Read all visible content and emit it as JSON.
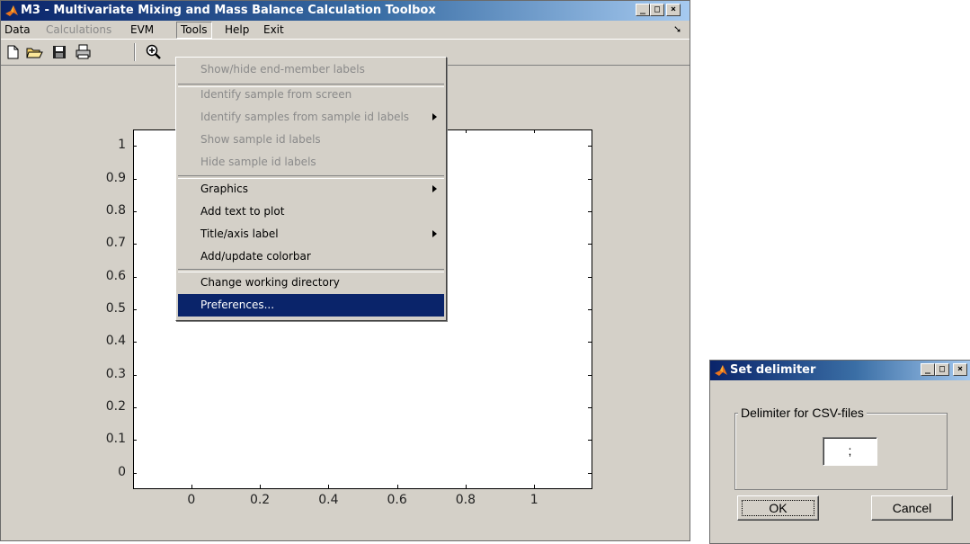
{
  "main_window": {
    "title": "M3 - Multivariate Mixing and Mass Balance Calculation Toolbox",
    "menubar": [
      {
        "label": "Data",
        "disabled": false
      },
      {
        "label": "Calculations",
        "disabled": true
      },
      {
        "label": "EVM",
        "disabled": false
      },
      {
        "label": "Tools",
        "disabled": false,
        "open": true
      },
      {
        "label": "Help",
        "disabled": false
      },
      {
        "label": "Exit",
        "disabled": false
      }
    ],
    "toolbar_icons": [
      "new-file-icon",
      "open-folder-icon",
      "save-icon",
      "print-icon",
      "zoom-in-icon"
    ]
  },
  "tools_menu": {
    "items": [
      {
        "label": "Show/hide end-member labels",
        "disabled": true
      },
      {
        "label": "Identify sample from screen",
        "disabled": true
      },
      {
        "label": "Identify samples from sample id labels",
        "disabled": true,
        "submenu": true
      },
      {
        "label": "Show sample id labels",
        "disabled": true
      },
      {
        "label": "Hide sample id labels",
        "disabled": true
      },
      {
        "label": "Graphics",
        "disabled": false,
        "submenu": true
      },
      {
        "label": "Add text to plot",
        "disabled": false
      },
      {
        "label": "Title/axis label",
        "disabled": false,
        "submenu": true
      },
      {
        "label": "Add/update colorbar",
        "disabled": false
      },
      {
        "label": "Change working directory",
        "disabled": false
      },
      {
        "label": "Preferences...",
        "disabled": false,
        "highlighted": true
      }
    ]
  },
  "chart_data": {
    "type": "scatter",
    "x_ticks": [
      "0",
      "0.2",
      "0.4",
      "0.6",
      "0.8",
      "1"
    ],
    "y_ticks": [
      "0",
      "0.1",
      "0.2",
      "0.3",
      "0.4",
      "0.5",
      "0.6",
      "0.7",
      "0.8",
      "0.9",
      "1"
    ],
    "xlim": [
      -0.17,
      1.17
    ],
    "ylim": [
      -0.05,
      1.05
    ],
    "series": []
  },
  "dialog": {
    "title": "Set delimiter",
    "group_label": "Delimiter for CSV-files",
    "delimiter_value": ";",
    "ok_label": "OK",
    "cancel_label": "Cancel"
  },
  "colors": {
    "title_active": "#0a246a",
    "highlight": "#0a246a",
    "face": "#d4d0c8"
  }
}
